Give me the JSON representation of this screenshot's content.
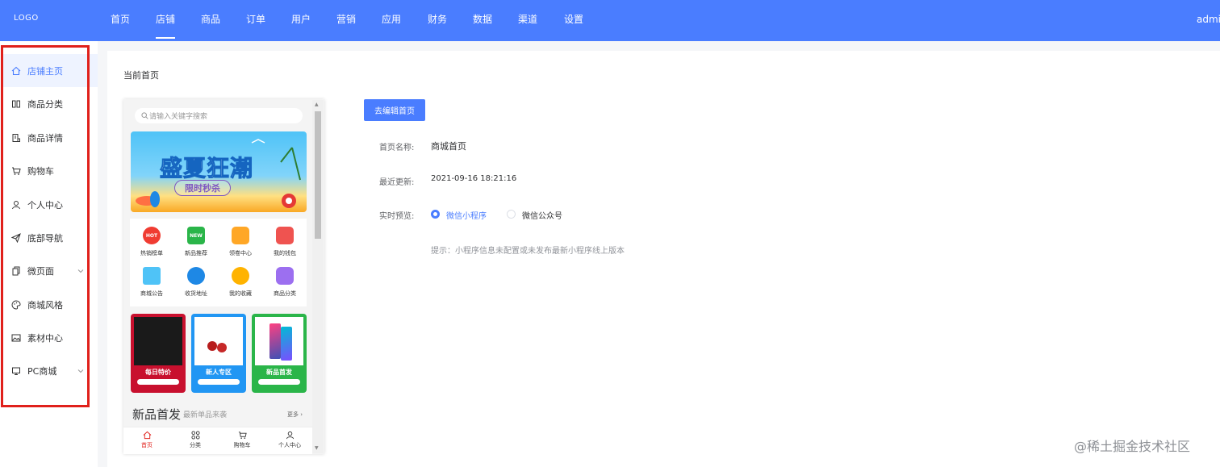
{
  "header": {
    "logo": "LOGO",
    "nav": [
      "首页",
      "店铺",
      "商品",
      "订单",
      "用户",
      "营销",
      "应用",
      "财务",
      "数据",
      "渠道",
      "设置"
    ],
    "active_nav": "店铺",
    "user": "admin",
    "bg_color": "#4a7dff"
  },
  "sidebar": {
    "items": [
      {
        "label": "店铺主页",
        "icon": "home-icon"
      },
      {
        "label": "商品分类",
        "icon": "category-icon"
      },
      {
        "label": "商品详情",
        "icon": "document-icon"
      },
      {
        "label": "购物车",
        "icon": "cart-icon"
      },
      {
        "label": "个人中心",
        "icon": "user-icon"
      },
      {
        "label": "底部导航",
        "icon": "send-icon"
      },
      {
        "label": "微页面",
        "icon": "pages-icon"
      },
      {
        "label": "商城风格",
        "icon": "palette-icon"
      },
      {
        "label": "素材中心",
        "icon": "image-icon"
      },
      {
        "label": "PC商城",
        "icon": "monitor-icon"
      }
    ],
    "highlight_color": "#e0201b"
  },
  "main": {
    "breadcrumb": "当前首页",
    "edit_button": "去编辑首页",
    "fields": {
      "name_label": "首页名称:",
      "name_value": "商城首页",
      "updated_label": "最近更新:",
      "updated_value": "2021-09-16 18:21:16",
      "preview_label": "实时预览:",
      "preview_options": [
        "微信小程序",
        "微信公众号"
      ]
    },
    "hint": "提示：小程序信息未配置或未发布最新小程序线上版本"
  },
  "preview": {
    "search_placeholder": "请输入关键字搜索",
    "banner_title": "盛夏狂潮",
    "banner_sub": "限时秒杀",
    "grid": [
      "热销榜单",
      "新品推荐",
      "领卷中心",
      "我的钱包",
      "商城公告",
      "收货地址",
      "我的收藏",
      "商品分类"
    ],
    "grid_badges": [
      "HOT",
      "NEW",
      "",
      "",
      "",
      "",
      "",
      ""
    ],
    "promos": [
      {
        "label": "每日特价",
        "color": "#c8102e"
      },
      {
        "label": "新人专区",
        "color": "#2196f3"
      },
      {
        "label": "新品首发",
        "color": "#2ab549"
      }
    ],
    "section_title": "新品首发",
    "section_sub": "最新单品来袭",
    "section_more": "更多 ›",
    "tabs": [
      "首页",
      "分类",
      "购物车",
      "个人中心"
    ]
  },
  "watermark": "@稀土掘金技术社区"
}
